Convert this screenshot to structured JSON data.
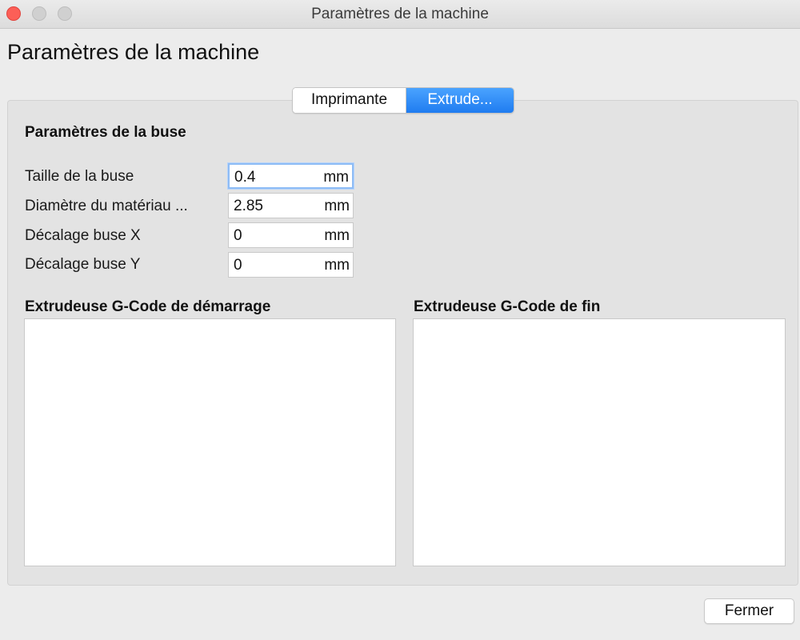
{
  "window": {
    "title": "Paramètres de la machine"
  },
  "page": {
    "heading": "Paramètres de la machine"
  },
  "tabs": [
    {
      "label": "Imprimante",
      "selected": false
    },
    {
      "label": "Extrude...",
      "selected": true
    }
  ],
  "nozzle_section": {
    "title": "Paramètres de la buse",
    "fields": [
      {
        "label": "Taille de la buse",
        "value": "0.4",
        "unit": "mm",
        "focused": true
      },
      {
        "label": "Diamètre du matériau ...",
        "value": "2.85",
        "unit": "mm",
        "focused": false
      },
      {
        "label": "Décalage buse X",
        "value": "0",
        "unit": "mm",
        "focused": false
      },
      {
        "label": "Décalage buse Y",
        "value": "0",
        "unit": "mm",
        "focused": false
      }
    ]
  },
  "gcode": {
    "start_title": "Extrudeuse G-Code de démarrage",
    "start_value": "",
    "end_title": "Extrudeuse G-Code de fin",
    "end_value": ""
  },
  "footer": {
    "close_label": "Fermer"
  },
  "colors": {
    "accent": "#1f7cf0",
    "close_button_red": "#fc5f57"
  }
}
